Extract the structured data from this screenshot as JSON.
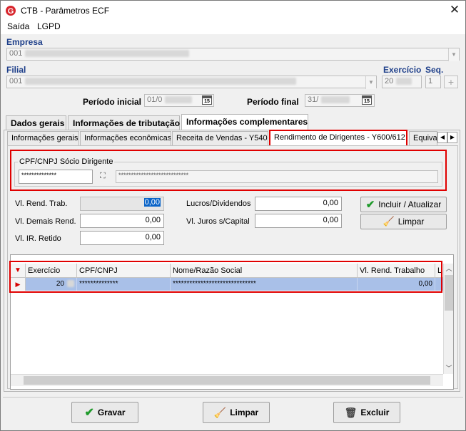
{
  "window": {
    "title": "CTB - Parâmetros ECF",
    "close_glyph": "✕"
  },
  "menu": [
    {
      "label": "Saída"
    },
    {
      "label": "LGPD"
    }
  ],
  "empresa": {
    "label": "Empresa",
    "code": "001"
  },
  "filial": {
    "label": "Filial",
    "code": "001"
  },
  "exercicio": {
    "label": "Exercício",
    "value": "20",
    "plus": "+"
  },
  "seq": {
    "label": "Seq.",
    "value": "1"
  },
  "periodo_inicial": {
    "label": "Período inicial",
    "value": "01/0"
  },
  "periodo_final": {
    "label": "Período final",
    "value": "31/"
  },
  "calendar_glyph": "15",
  "tabs": [
    {
      "label": "Dados gerais"
    },
    {
      "label": "Informações de tributação"
    },
    {
      "label": "Informações complementares"
    }
  ],
  "subtabs": [
    {
      "label": "Informações gerais"
    },
    {
      "label": "Informações econômicas"
    },
    {
      "label": "Receita de Vendas - Y540"
    },
    {
      "label": "Rendimento de Dirigentes - Y600/612"
    },
    {
      "label": "Equival"
    }
  ],
  "subtab_nav": {
    "left": "◀",
    "right": "▶"
  },
  "socio": {
    "group_label": "CPF/CNPJ Sócio Dirigente",
    "cpf": "**************",
    "name": "****************************",
    "binoculars": "⛶"
  },
  "form": {
    "rend_trab": {
      "label": "Vl. Rend. Trab.",
      "value": "0,00"
    },
    "demais_rend": {
      "label": "Vl. Demais Rend.",
      "value": "0,00"
    },
    "ir_retido": {
      "label": "Vl. IR. Retido",
      "value": "0,00"
    },
    "lucros": {
      "label": "Lucros/Dividendos",
      "value": "0,00"
    },
    "juros": {
      "label": "Vl. Juros s/Capital",
      "value": "0,00"
    }
  },
  "buttons": {
    "incluir": "Incluir / Atualizar",
    "limpar_small": "Limpar",
    "gravar": "Gravar",
    "limpar": "Limpar",
    "excluir": "Excluir"
  },
  "grid": {
    "columns": [
      "Exercício",
      "CPF/CNPJ",
      "Nome/Razão Social",
      "Vl. Rend. Trabalho",
      "L"
    ],
    "rows": [
      {
        "exercicio": "20",
        "cpf": "**************",
        "nome": "******************************",
        "vl": "0,00"
      }
    ]
  },
  "colors": {
    "accent_red": "#e00000",
    "label_blue": "#1e3f8a",
    "row_selected": "#a9c0e8"
  }
}
